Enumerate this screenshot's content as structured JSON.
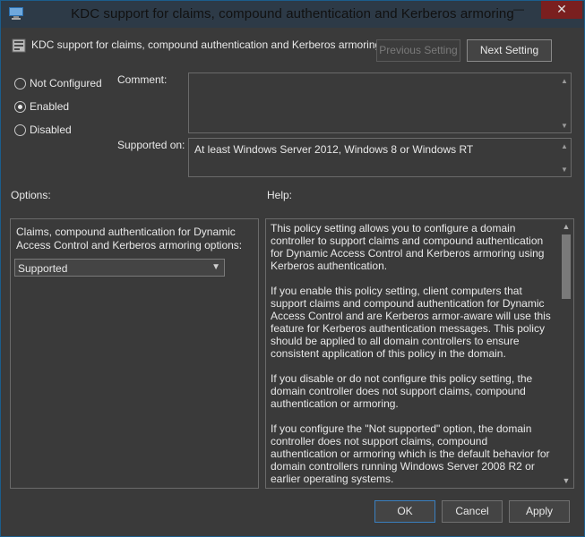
{
  "window": {
    "title": "KDC support for claims, compound authentication and Kerberos armoring",
    "minimize_glyph": "—",
    "maximize_glyph": "☐",
    "close_glyph": "✕"
  },
  "header": {
    "policy_name": "KDC support for claims, compound authentication and Kerberos armoring",
    "previous_label": "Previous Setting",
    "next_label": "Next Setting"
  },
  "state": {
    "options": [
      {
        "label": "Not Configured",
        "checked": false
      },
      {
        "label": "Enabled",
        "checked": true
      },
      {
        "label": "Disabled",
        "checked": false
      }
    ]
  },
  "comment": {
    "label": "Comment:",
    "value": ""
  },
  "supported_on": {
    "label": "Supported on:",
    "value": "At least Windows Server 2012, Windows 8 or Windows RT"
  },
  "options_section": {
    "label": "Options:",
    "description": "Claims, compound authentication for Dynamic Access Control and Kerberos armoring options:",
    "selected": "Supported"
  },
  "help_section": {
    "label": "Help:",
    "paragraphs": [
      "This policy setting allows you to configure a domain controller to support claims and compound authentication for Dynamic Access Control and Kerberos armoring using Kerberos authentication.",
      "If you enable this policy setting, client computers that support claims and compound authentication for Dynamic Access Control and are Kerberos armor-aware will use this feature for Kerberos authentication messages. This policy should be applied to all domain controllers to ensure consistent application of this policy in the domain.",
      "If you disable or do not configure this policy setting, the domain controller does not support claims, compound authentication or armoring.",
      "If you configure the \"Not supported\" option, the domain controller does not support claims, compound authentication or armoring which is the default behavior for domain controllers running Windows Server 2008 R2 or earlier operating systems."
    ]
  },
  "footer": {
    "ok_label": "OK",
    "cancel_label": "Cancel",
    "apply_label": "Apply"
  },
  "colors": {
    "background": "#3a3a3a",
    "title_bar": "#2d3a47",
    "close_button": "#7a1f1f",
    "default_button_border": "#3a7fbf"
  },
  "icons": [
    "app-icon",
    "policy-setting-icon",
    "radio-icon",
    "chevron-down-icon",
    "scroll-up-icon",
    "scroll-down-icon"
  ]
}
